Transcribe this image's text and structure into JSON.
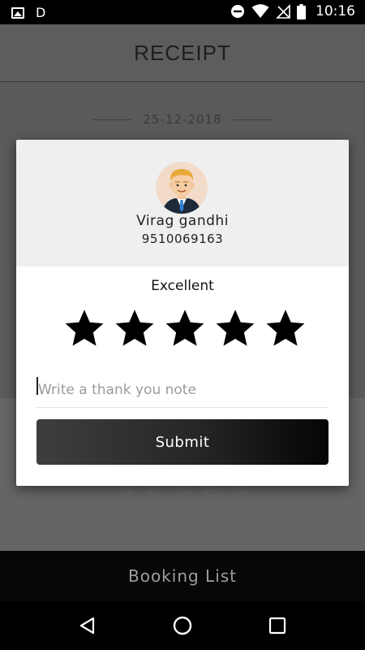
{
  "status_bar": {
    "notification_letter": "D",
    "time": "10:16",
    "icons": [
      "image-icon",
      "dnd-icon",
      "wifi-icon",
      "no-signal-icon",
      "battery-icon"
    ]
  },
  "header": {
    "title": "RECEIPT"
  },
  "receipt": {
    "date": "25-12-2018"
  },
  "rating_dialog": {
    "driver": {
      "name": "Virag gandhi",
      "phone": "9510069163",
      "avatar_icon": "driver-avatar-icon"
    },
    "rating_label": "Excellent",
    "rating": 5,
    "max_rating": 5,
    "note": {
      "value": "",
      "placeholder": "Write a thank you note"
    },
    "submit_label": "Submit"
  },
  "bottom_bar": {
    "label": "Booking List"
  },
  "colors": {
    "dialog_bg": "#ffffff",
    "dialog_top_bg": "#efefef",
    "overlay_bg": "#5a5a5a",
    "button_gradient_start": "#3e3e3e",
    "button_gradient_end": "#050505",
    "star": "#000000"
  },
  "nav_bar": {
    "icons": [
      "back-icon",
      "home-icon",
      "recents-icon"
    ]
  }
}
